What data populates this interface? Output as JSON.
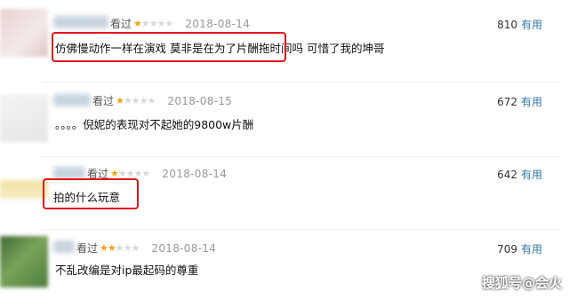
{
  "reviews": [
    {
      "seen": "看过",
      "rating": 1,
      "date": "2018-08-14",
      "votes": "810",
      "useful": "有用",
      "comment": "仿佛慢动作一样在演戏 莫非是在为了片酬拖时间吗 可惜了我的坤哥",
      "highlighted": true
    },
    {
      "seen": "看过",
      "rating": 1,
      "date": "2018-08-15",
      "votes": "672",
      "useful": "有用",
      "comment": "。。。。倪妮的表现对不起她的9800w片酬",
      "highlighted": false
    },
    {
      "seen": "看过",
      "rating": 1,
      "date": "2018-08-14",
      "votes": "642",
      "useful": "有用",
      "comment": "拍的什么玩意",
      "highlighted": true
    },
    {
      "seen": "看过",
      "rating": 2,
      "date": "2018-08-14",
      "votes": "709",
      "useful": "有用",
      "comment": "不乱改编是对ip最起码的尊重",
      "highlighted": false
    }
  ],
  "watermark": "搜狐号@会火",
  "colors": {
    "star": "#f0a414",
    "highlight": "#e8141a",
    "useful": "#3377aa"
  }
}
